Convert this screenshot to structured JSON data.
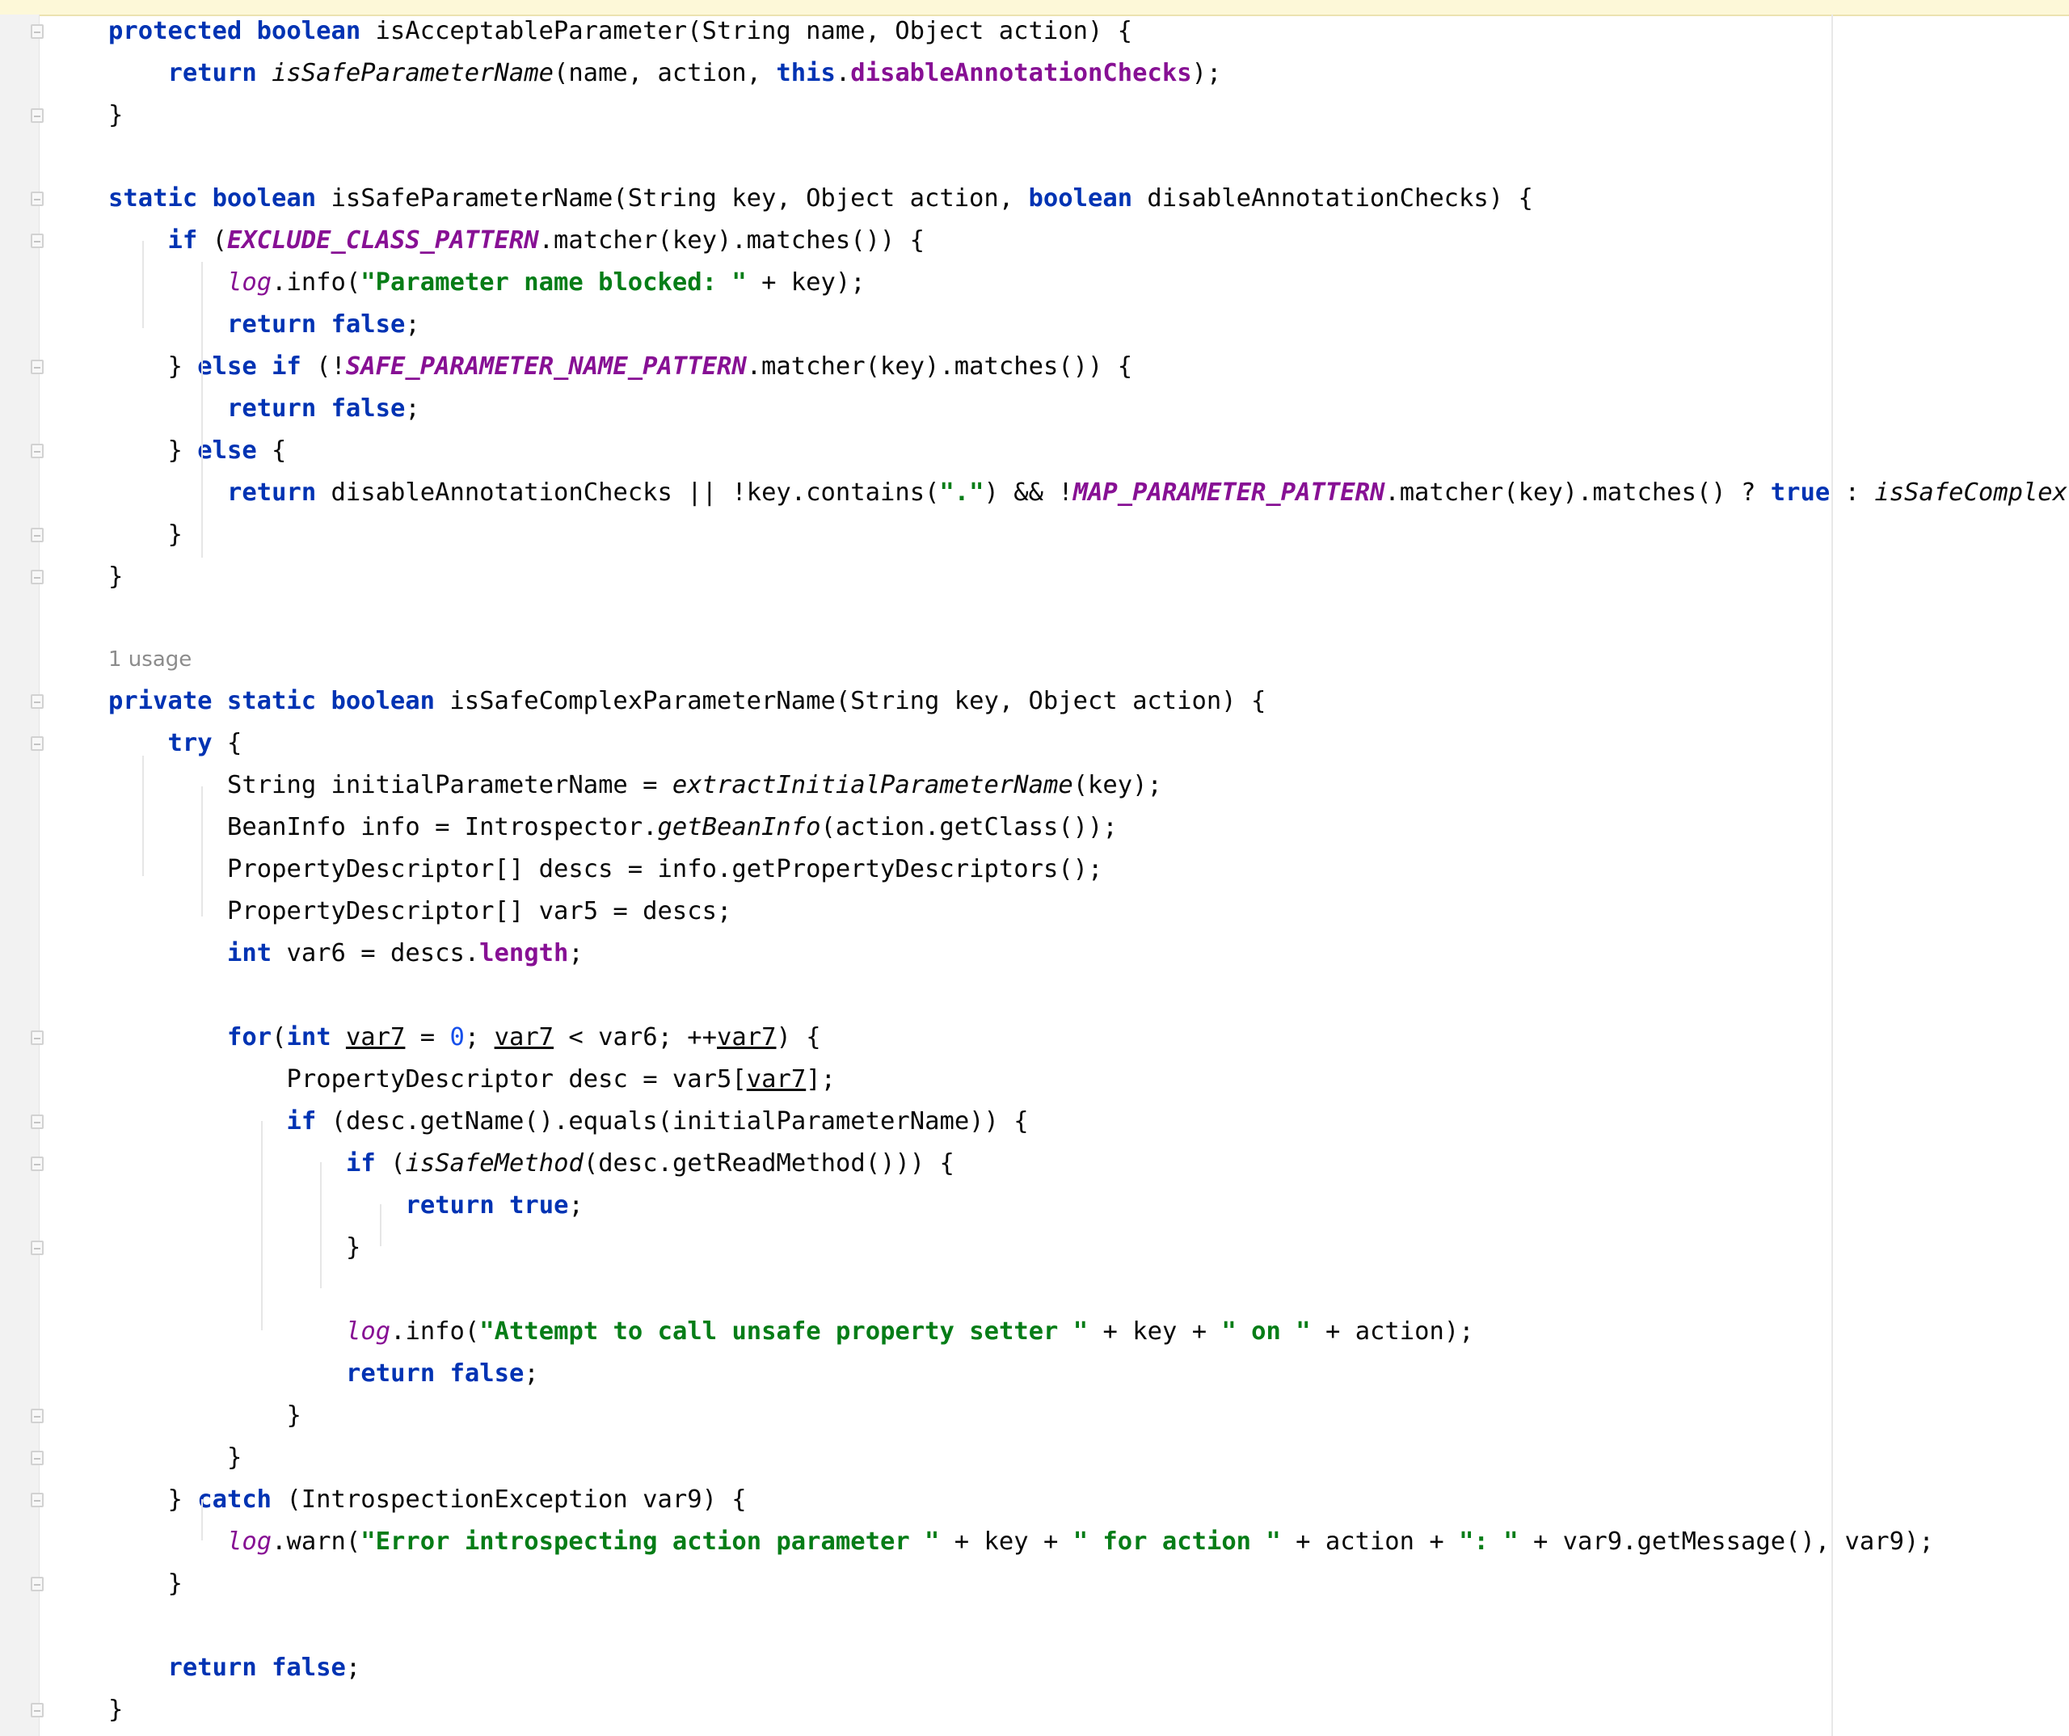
{
  "editor": {
    "language": "Java",
    "usage_hint": "1 usage",
    "colors": {
      "keyword": "#0033b3",
      "field": "#871094",
      "string": "#067d17",
      "number": "#1750eb",
      "text": "#080808",
      "hint": "#8c8c8c"
    },
    "lines": [
      [
        [
          "kw",
          "protected"
        ],
        [
          "t",
          " "
        ],
        [
          "kw",
          "boolean"
        ],
        [
          "t",
          " isAcceptableParameter(String name, Object action) {"
        ]
      ],
      [
        [
          "kw",
          "return"
        ],
        [
          "t",
          " "
        ],
        [
          "it",
          "isSafeParameterName"
        ],
        [
          "t",
          "(name, action, "
        ],
        [
          "kw",
          "this"
        ],
        [
          "t",
          "."
        ],
        [
          "fld",
          "disableAnnotationChecks"
        ],
        [
          "t",
          ");"
        ]
      ],
      [
        [
          "t",
          "}"
        ]
      ],
      [],
      [
        [
          "kw",
          "static"
        ],
        [
          "t",
          " "
        ],
        [
          "kw",
          "boolean"
        ],
        [
          "t",
          " isSafeParameterName(String key, Object action, "
        ],
        [
          "kw",
          "boolean"
        ],
        [
          "t",
          " disableAnnotationChecks) {"
        ]
      ],
      [
        [
          "kw",
          "if"
        ],
        [
          "t",
          " ("
        ],
        [
          "sfi",
          "EXCLUDE_CLASS_PATTERN"
        ],
        [
          "t",
          ".matcher(key).matches()) {"
        ]
      ],
      [
        [
          "lg",
          "log"
        ],
        [
          "t",
          ".info("
        ],
        [
          "str",
          "\"Parameter name blocked: \""
        ],
        [
          "t",
          " + key);"
        ]
      ],
      [
        [
          "kw",
          "return"
        ],
        [
          "t",
          " "
        ],
        [
          "kw",
          "false"
        ],
        [
          "t",
          ";"
        ]
      ],
      [
        [
          "t",
          "} "
        ],
        [
          "kw",
          "else"
        ],
        [
          "t",
          " "
        ],
        [
          "kw",
          "if"
        ],
        [
          "t",
          " (!"
        ],
        [
          "sfi",
          "SAFE_PARAMETER_NAME_PATTERN"
        ],
        [
          "t",
          ".matcher(key).matches()) {"
        ]
      ],
      [
        [
          "kw",
          "return"
        ],
        [
          "t",
          " "
        ],
        [
          "kw",
          "false"
        ],
        [
          "t",
          ";"
        ]
      ],
      [
        [
          "t",
          "} "
        ],
        [
          "kw",
          "else"
        ],
        [
          "t",
          " {"
        ]
      ],
      [
        [
          "kw",
          "return"
        ],
        [
          "t",
          " disableAnnotationChecks || !key.contains("
        ],
        [
          "str",
          "\".\""
        ],
        [
          "t",
          ") && !"
        ],
        [
          "sfi",
          "MAP_PARAMETER_PATTERN"
        ],
        [
          "t",
          ".matcher(key).matches() ? "
        ],
        [
          "kw",
          "true"
        ],
        [
          "t",
          " : "
        ],
        [
          "it",
          "isSafeComplex"
        ]
      ],
      [
        [
          "t",
          "}"
        ]
      ],
      [
        [
          "t",
          "}"
        ]
      ],
      [],
      [],
      [
        [
          "kw",
          "private"
        ],
        [
          "t",
          " "
        ],
        [
          "kw",
          "static"
        ],
        [
          "t",
          " "
        ],
        [
          "kw",
          "boolean"
        ],
        [
          "t",
          " isSafeComplexParameterName(String key, Object action) {"
        ]
      ],
      [
        [
          "kw",
          "try"
        ],
        [
          "t",
          " {"
        ]
      ],
      [
        [
          "t",
          "String initialParameterName = "
        ],
        [
          "it",
          "extractInitialParameterName"
        ],
        [
          "t",
          "(key);"
        ]
      ],
      [
        [
          "t",
          "BeanInfo info = Introspector."
        ],
        [
          "it",
          "getBeanInfo"
        ],
        [
          "t",
          "(action.getClass());"
        ]
      ],
      [
        [
          "t",
          "PropertyDescriptor[] descs = info.getPropertyDescriptors();"
        ]
      ],
      [
        [
          "t",
          "PropertyDescriptor[] var5 = descs;"
        ]
      ],
      [
        [
          "kw",
          "int"
        ],
        [
          "t",
          " var6 = descs."
        ],
        [
          "fld",
          "length"
        ],
        [
          "t",
          ";"
        ]
      ],
      [],
      [
        [
          "kw",
          "for"
        ],
        [
          "t",
          "("
        ],
        [
          "kw",
          "int"
        ],
        [
          "t",
          " "
        ],
        [
          "ul",
          "var7"
        ],
        [
          "t",
          " = "
        ],
        [
          "num",
          "0"
        ],
        [
          "t",
          "; "
        ],
        [
          "ul",
          "var7"
        ],
        [
          "t",
          " < var6; ++"
        ],
        [
          "ul",
          "var7"
        ],
        [
          "t",
          ") {"
        ]
      ],
      [
        [
          "t",
          "PropertyDescriptor desc = var5["
        ],
        [
          "ul",
          "var7"
        ],
        [
          "t",
          "];"
        ]
      ],
      [
        [
          "kw",
          "if"
        ],
        [
          "t",
          " (desc.getName().equals(initialParameterName)) {"
        ]
      ],
      [
        [
          "kw",
          "if"
        ],
        [
          "t",
          " ("
        ],
        [
          "it",
          "isSafeMethod"
        ],
        [
          "t",
          "(desc.getReadMethod())) {"
        ]
      ],
      [
        [
          "kw",
          "return"
        ],
        [
          "t",
          " "
        ],
        [
          "kw",
          "true"
        ],
        [
          "t",
          ";"
        ]
      ],
      [
        [
          "t",
          "}"
        ]
      ],
      [],
      [
        [
          "lg",
          "log"
        ],
        [
          "t",
          ".info("
        ],
        [
          "str",
          "\"Attempt to call unsafe property setter \""
        ],
        [
          "t",
          " + key + "
        ],
        [
          "str",
          "\" on \""
        ],
        [
          "t",
          " + action);"
        ]
      ],
      [
        [
          "kw",
          "return"
        ],
        [
          "t",
          " "
        ],
        [
          "kw",
          "false"
        ],
        [
          "t",
          ";"
        ]
      ],
      [
        [
          "t",
          "}"
        ]
      ],
      [
        [
          "t",
          "}"
        ]
      ],
      [
        [
          "t",
          "} "
        ],
        [
          "kw",
          "catch"
        ],
        [
          "t",
          " (IntrospectionException var9) {"
        ]
      ],
      [
        [
          "lg",
          "log"
        ],
        [
          "t",
          ".warn("
        ],
        [
          "str",
          "\"Error introspecting action parameter \""
        ],
        [
          "t",
          " + key + "
        ],
        [
          "str",
          "\" for action \""
        ],
        [
          "t",
          " + action + "
        ],
        [
          "str",
          "\": \""
        ],
        [
          "t",
          " + var9.getMessage(), var9);"
        ]
      ],
      [
        [
          "t",
          "}"
        ]
      ],
      [],
      [
        [
          "kw",
          "return"
        ],
        [
          "t",
          " "
        ],
        [
          "kw",
          "false"
        ],
        [
          "t",
          ";"
        ]
      ],
      [
        [
          "t",
          "}"
        ]
      ]
    ]
  }
}
